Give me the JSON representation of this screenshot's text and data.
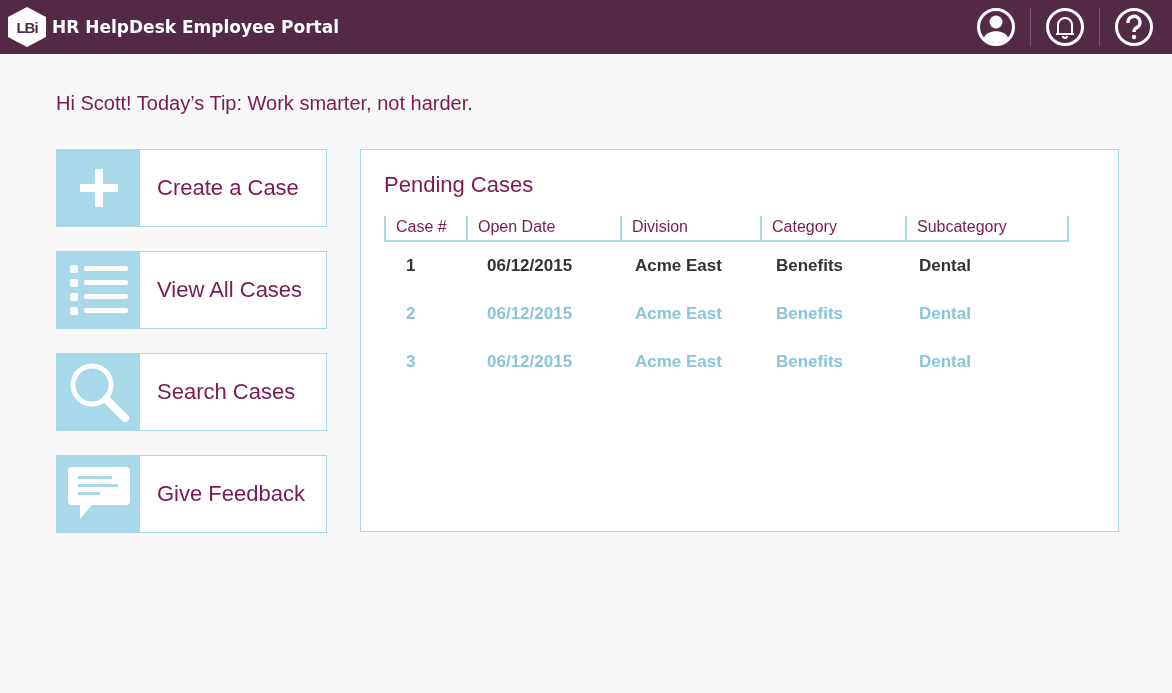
{
  "header": {
    "logo": "LBi",
    "title": "HR HelpDesk Employee Portal",
    "icons": [
      {
        "kind": "user"
      },
      {
        "kind": "bell"
      },
      {
        "kind": "help"
      }
    ]
  },
  "greeting": "Hi Scott! Today’s Tip: Work smarter, not harder.",
  "actions": [
    {
      "kind": "plus",
      "label": "Create a Case"
    },
    {
      "kind": "list",
      "label": "View All Cases"
    },
    {
      "kind": "search",
      "label": "Search Cases"
    },
    {
      "kind": "chat",
      "label": "Give Feedback"
    }
  ],
  "pending": {
    "title": "Pending Cases",
    "columns": [
      "Case #",
      "Open Date",
      "Division",
      "Category",
      "Subcategory"
    ],
    "rows": [
      {
        "selected": true,
        "cells": [
          "1",
          "06/12/2015",
          "Acme East",
          "Benefits",
          "Dental"
        ]
      },
      {
        "selected": false,
        "cells": [
          "2",
          "06/12/2015",
          "Acme East",
          "Benefits",
          "Dental"
        ]
      },
      {
        "selected": false,
        "cells": [
          "3",
          "06/12/2015",
          "Acme East",
          "Benefits",
          "Dental"
        ]
      }
    ]
  }
}
